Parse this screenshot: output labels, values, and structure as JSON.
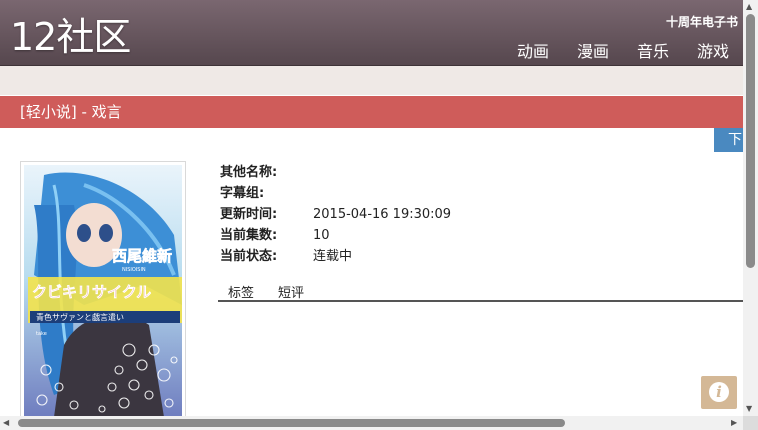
{
  "header": {
    "logo": "12社区",
    "promo": "十周年电子书",
    "nav": [
      "动画",
      "漫画",
      "音乐",
      "游戏"
    ]
  },
  "category": {
    "title": "[轻小说] - 戏言"
  },
  "download_button": {
    "label": "下"
  },
  "cover": {
    "author_text": "西尾維新",
    "author_romaji": "NISIOISIN",
    "title_text": "クビキリサイクル",
    "subtitle_text": "青色サヴァンと戯言遣い",
    "illustrator": "take"
  },
  "info": {
    "rows": [
      {
        "label": "其他名称:",
        "value": ""
      },
      {
        "label": "字幕组:",
        "value": ""
      },
      {
        "label": "更新时间:",
        "value": "2015-04-16 19:30:09"
      },
      {
        "label": "当前集数:",
        "value": "10"
      },
      {
        "label": "当前状态:",
        "value": "连载中"
      }
    ]
  },
  "tabs": [
    "标签",
    "短评"
  ],
  "info_button": {
    "glyph": "i"
  },
  "colors": {
    "header": "#5c4c54",
    "category_bar": "#cf5c5a",
    "download_button": "#4a89c0",
    "info_button": "#d4b896"
  }
}
